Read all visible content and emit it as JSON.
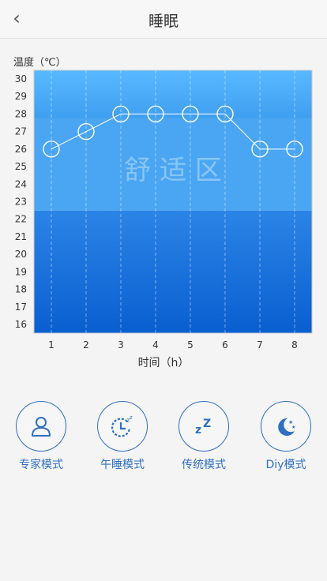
{
  "header": {
    "title": "睡眠",
    "back_icon": "chevron-left-icon"
  },
  "chart_data": {
    "type": "line",
    "ylabel": "温度（℃）",
    "xlabel": "时间（h）",
    "watermark": "舒 适 区",
    "x": [
      1,
      2,
      3,
      4,
      5,
      6,
      7,
      8
    ],
    "values": [
      26,
      27,
      28,
      28,
      28,
      28,
      26,
      26
    ],
    "ylim": [
      16,
      30
    ],
    "yticks": [
      30,
      29,
      28,
      27,
      26,
      25,
      24,
      23,
      22,
      21,
      20,
      19,
      18,
      17,
      16
    ],
    "comfort_band": [
      22,
      28
    ],
    "grid": true,
    "colors": {
      "top": "#5ab8ff",
      "bottom": "#0a62d2",
      "line": "#ffffff"
    }
  },
  "modes": [
    {
      "label": "专家模式",
      "icon": "person-icon"
    },
    {
      "label": "午睡模式",
      "icon": "clock-sleep-icon"
    },
    {
      "label": "传统模式",
      "icon": "zz-icon"
    },
    {
      "label": "Diy模式",
      "icon": "moon-stars-icon"
    }
  ],
  "accent": "#2f6fc0"
}
